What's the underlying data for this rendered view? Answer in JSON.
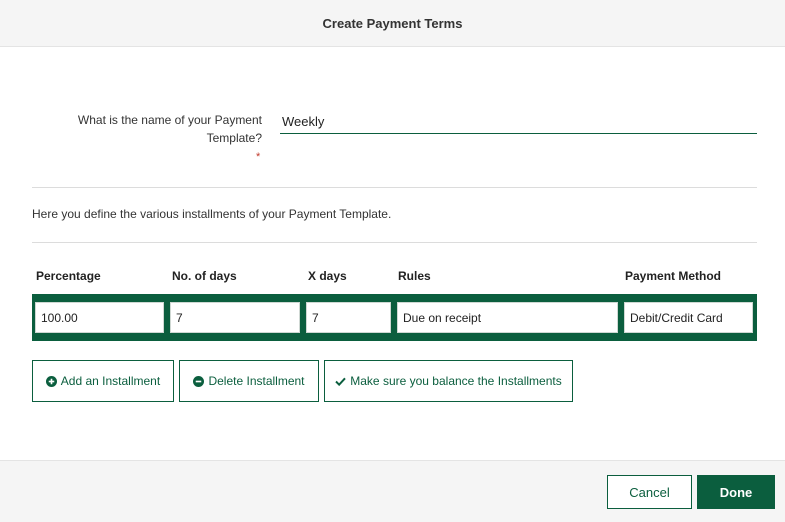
{
  "dialog": {
    "title": "Create Payment Terms"
  },
  "form": {
    "name_label": "What is the name of your Payment Template?",
    "required_mark": "*",
    "name_value": "Weekly"
  },
  "intro_text": "Here you define the various installments of your Payment Template.",
  "table": {
    "headers": [
      "Percentage",
      "No. of days",
      "X days",
      "Rules",
      "Payment Method"
    ],
    "rows": [
      {
        "percentage": "100.00",
        "days": "7",
        "x_days": "7",
        "rules": "Due on receipt",
        "payment_method": "Debit/Credit Card"
      }
    ]
  },
  "actions": {
    "add_label": "Add an Installment",
    "delete_label": "Delete Installment",
    "balance_label": "Make sure you balance the Installments"
  },
  "footer": {
    "cancel_label": "Cancel",
    "done_label": "Done"
  },
  "colors": {
    "accent": "#0b5e3e",
    "required": "#c0392b",
    "header_bg": "#f5f5f5"
  },
  "icons": {
    "add": "plus-circle-icon",
    "delete": "minus-circle-icon",
    "balance": "check-icon"
  }
}
